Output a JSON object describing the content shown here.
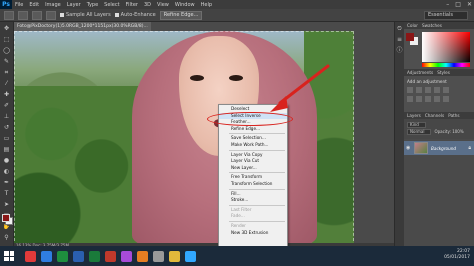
{
  "app": {
    "logo": "Ps",
    "menu": [
      "File",
      "Edit",
      "Image",
      "Layer",
      "Type",
      "Select",
      "Filter",
      "3D",
      "View",
      "Window",
      "Help"
    ],
    "window_controls": [
      "–",
      "□",
      "✕"
    ]
  },
  "options_bar": {
    "sample_all_layers": "Sample All Layers",
    "auto_enhance": "Auto-Enhance",
    "refine_edge": "Refine Edge...",
    "workspace": "Essentials"
  },
  "document": {
    "tab_title": "Foto@PixDoctory(1)5.0RGB_1200*1151px(30.0%RGB/8)..."
  },
  "context_menu": {
    "items": [
      {
        "label": "Deselect",
        "disabled": false,
        "highlight": false
      },
      {
        "label": "Select Inverse",
        "disabled": false,
        "highlight": true
      },
      {
        "label": "Feather...",
        "disabled": false,
        "highlight": false
      },
      {
        "label": "Refine Edge...",
        "disabled": false,
        "highlight": false
      },
      {
        "sep": true
      },
      {
        "label": "Save Selection...",
        "disabled": false,
        "highlight": false
      },
      {
        "label": "Make Work Path...",
        "disabled": false,
        "highlight": false
      },
      {
        "sep": true
      },
      {
        "label": "Layer Via Copy",
        "disabled": false,
        "highlight": false
      },
      {
        "label": "Layer Via Cut",
        "disabled": false,
        "highlight": false
      },
      {
        "label": "New Layer...",
        "disabled": false,
        "highlight": false
      },
      {
        "sep": true
      },
      {
        "label": "Free Transform",
        "disabled": false,
        "highlight": false
      },
      {
        "label": "Transform Selection",
        "disabled": false,
        "highlight": false
      },
      {
        "sep": true
      },
      {
        "label": "Fill...",
        "disabled": false,
        "highlight": false
      },
      {
        "label": "Stroke...",
        "disabled": false,
        "highlight": false
      },
      {
        "sep": true
      },
      {
        "label": "Last Filter",
        "disabled": true,
        "highlight": false
      },
      {
        "label": "Fade...",
        "disabled": true,
        "highlight": false
      },
      {
        "sep": true
      },
      {
        "label": "Render",
        "disabled": true,
        "highlight": false
      },
      {
        "label": "New 3D Extrusion",
        "disabled": false,
        "highlight": false
      }
    ]
  },
  "status_bar": {
    "text": "16.13%    Doc: 3.75M/3.75M"
  },
  "panels": {
    "color_tabs": [
      "Color",
      "Swatches"
    ],
    "adjustments_tabs": [
      "Adjustments",
      "Styles"
    ],
    "adjustments_label": "Add an adjustment",
    "layers_tabs": [
      "Layers",
      "Channels",
      "Paths"
    ],
    "kind_label": "Kind",
    "blend_mode": "Normal",
    "opacity_label": "Opacity: 100%",
    "lock_label": "Lock:",
    "fill_label": "Fill: 100%",
    "layer_name": "Background"
  },
  "taskbar": {
    "time": "22:07",
    "date": "05/01/2017",
    "icon_colors": [
      "#e03a3a",
      "#2f7de1",
      "#1e8e3e",
      "#2a5fb0",
      "#1a7a3a",
      "#c0392b",
      "#a74bd8",
      "#e67e22",
      "#999999",
      "#e2b93b",
      "#31a8ff"
    ]
  },
  "colors": {
    "annotation_red": "#d8231e",
    "menu_highlight": "#cfe2f6",
    "foreground": "#8a1616"
  }
}
